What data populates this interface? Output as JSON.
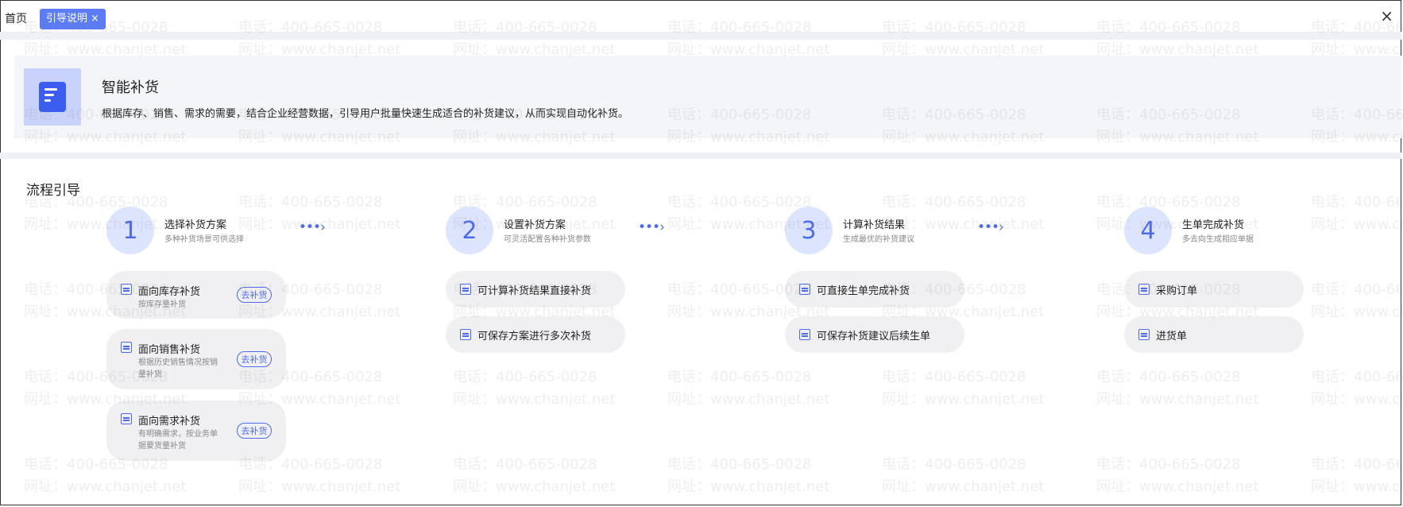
{
  "tabs": {
    "home": "首页",
    "active": "引导说明",
    "active_close": "×"
  },
  "window": {
    "close": "×"
  },
  "banner": {
    "icon": "smart-replenish-icon",
    "title": "智能补货",
    "desc": "根据库存、销售、需求的需要，结合企业经营数据，引导用户批量快速生成适合的补货建议，从而实现自动化补货。"
  },
  "section_title": "流程引导",
  "arrow_glyph": "•••›",
  "steps": [
    {
      "num": "1",
      "title": "选择补货方案",
      "sub": "多种补货场景可供选择",
      "options": [
        {
          "label": "面向库存补货",
          "sub": "按库存量补货",
          "icon": "warehouse-icon",
          "action": "去补货"
        },
        {
          "label": "面向销售补货",
          "sub": "根据历史销售情况按销量补货",
          "icon": "sales-icon",
          "action": "去补货"
        },
        {
          "label": "面向需求补货",
          "sub": "有明确需求，按业务单据要货量补货",
          "icon": "demand-icon",
          "action": "去补货"
        }
      ]
    },
    {
      "num": "2",
      "title": "设置补货方案",
      "sub": "可灵活配置各种补货参数",
      "options": [
        {
          "label": "可计算补货结果直接补货",
          "icon": "list-icon"
        },
        {
          "label": "可保存方案进行多次补货",
          "icon": "doc-settings-icon"
        }
      ]
    },
    {
      "num": "3",
      "title": "计算补货结果",
      "sub": "生成最优的补货建议",
      "options": [
        {
          "label": "可直接生单完成补货",
          "icon": "list-icon"
        },
        {
          "label": "可保存补货建议后续生单",
          "icon": "calculator-icon"
        }
      ]
    },
    {
      "num": "4",
      "title": "生单完成补货",
      "sub": "多去向生成相应单据",
      "options": [
        {
          "label": "采购订单",
          "icon": "order-icon"
        },
        {
          "label": "进货单",
          "icon": "receipt-icon"
        }
      ]
    }
  ],
  "watermark": {
    "phone": "电话：400-665-0028",
    "site": "网址：www.chanjet.net"
  }
}
